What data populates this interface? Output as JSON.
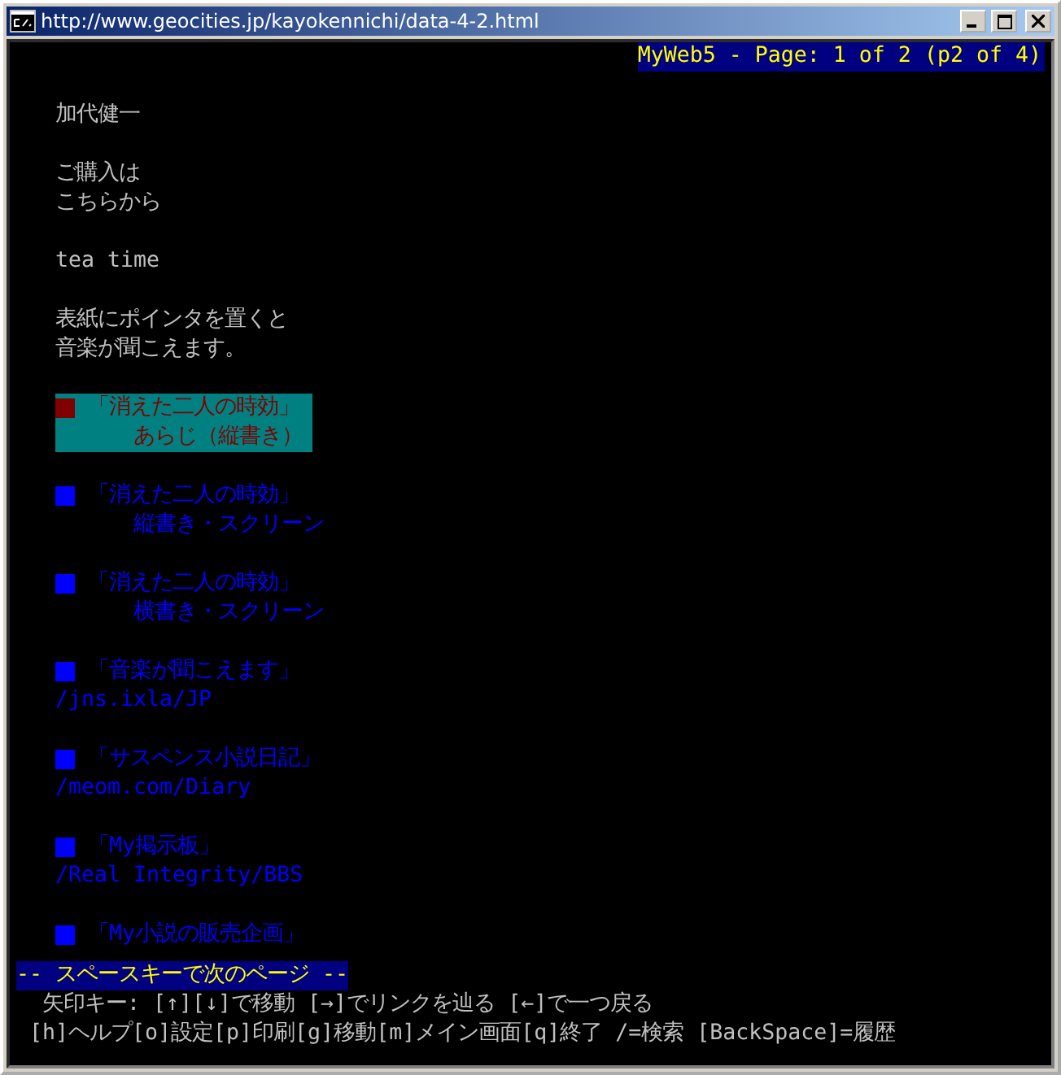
{
  "window": {
    "title": "http://www.geocities.jp/kayokennichi/data-4-2.html"
  },
  "header": "MyWeb5 - Page: 1 of 2 (p2 of 4)",
  "blocks": [
    {
      "kind": "text",
      "lines": [
        "加代健一"
      ]
    },
    {
      "kind": "text",
      "lines": [
        "ご購入は",
        "こちらから"
      ]
    },
    {
      "kind": "text",
      "lines": [
        "tea time"
      ]
    },
    {
      "kind": "text",
      "lines": [
        "表紙にポインタを置くと",
        "音楽が聞こえます。"
      ]
    },
    {
      "kind": "link",
      "selected": true,
      "title": "「消えた二人の時効」",
      "caption": "あらじ（縦書き）"
    },
    {
      "kind": "link",
      "selected": false,
      "title": "「消えた二人の時効」",
      "caption": "縦書き・スクリーン"
    },
    {
      "kind": "link",
      "selected": false,
      "title": "「消えた二人の時効」",
      "caption": "横書き・スクリーン"
    },
    {
      "kind": "link",
      "selected": false,
      "title": "「音楽が聞こえます」",
      "url": "/jns.ixla/JP"
    },
    {
      "kind": "link",
      "selected": false,
      "title": "「サスペンス小説日記」",
      "url": "/meom.com/Diary"
    },
    {
      "kind": "link",
      "selected": false,
      "title": "「My掲示板」",
      "url": "/Real Integrity/BBS"
    },
    {
      "kind": "link",
      "selected": false,
      "title": "「My小説の販売企画」"
    }
  ],
  "status": {
    "prompt": "-- スペースキーで次のページ --",
    "help": [
      "矢印キー: [↑][↓]で移動 [→]でリンクを辿る [←]で一つ戻る",
      "[h]ヘルプ[o]設定[p]印刷[g]移動[m]メイン画面[q]終了 /=検索 [BackSpace]=履歴"
    ]
  }
}
